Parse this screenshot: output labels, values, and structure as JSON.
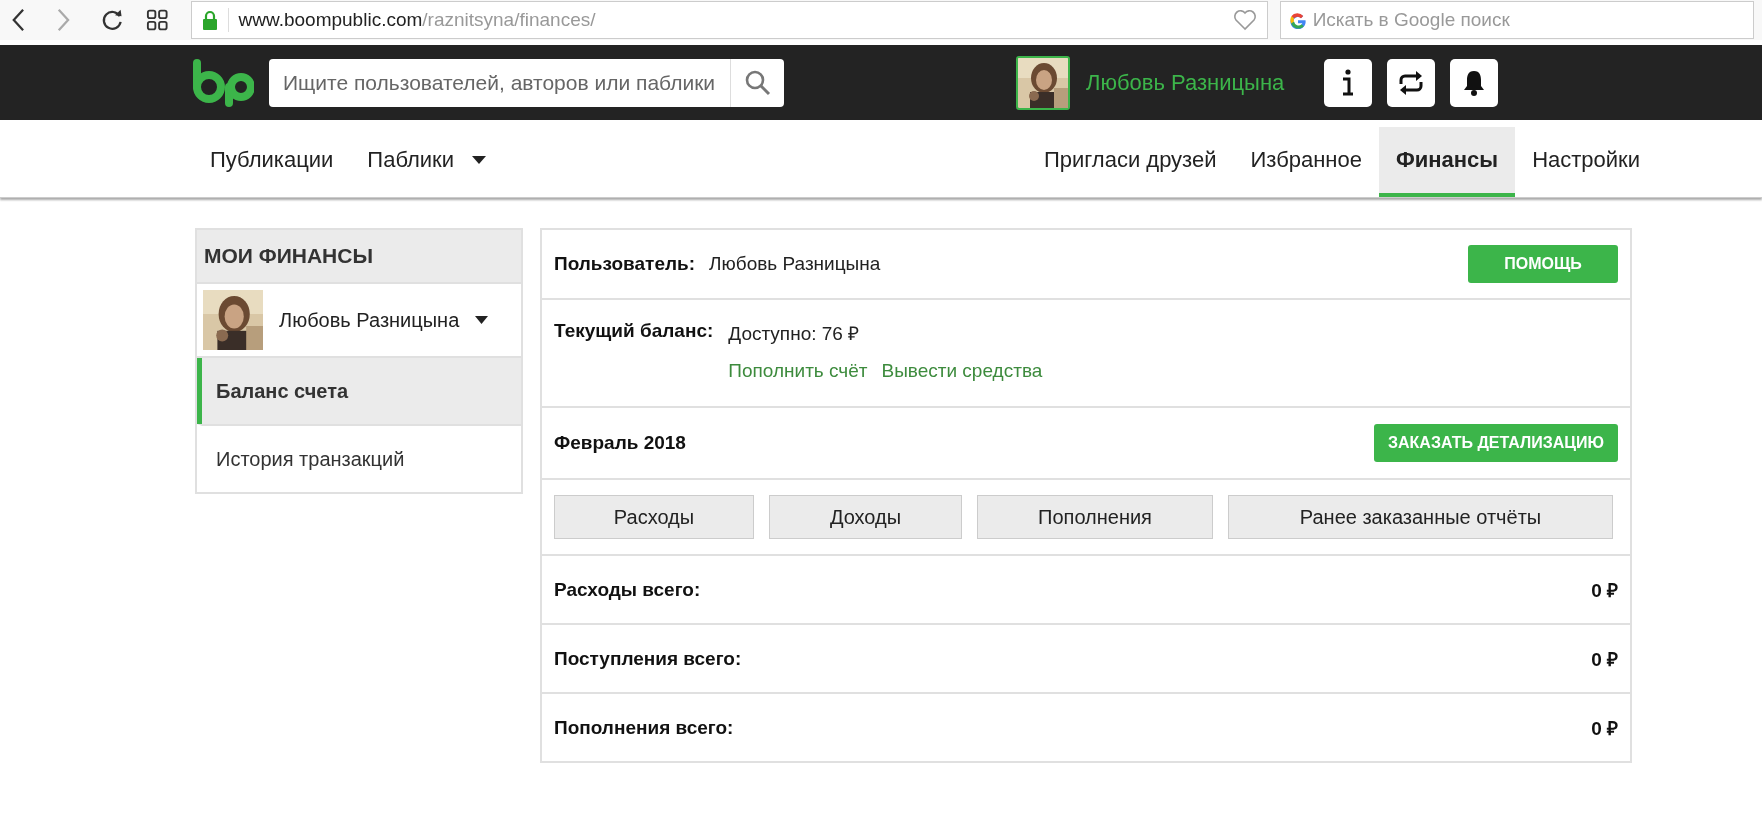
{
  "browser": {
    "url": {
      "domain": "www.boompublic.com",
      "path": "/raznitsyna/finances/"
    },
    "search": {
      "placeholder": "Искать в Google поиск"
    }
  },
  "header": {
    "search": {
      "placeholder": "Ищите пользователей, авторов или паблики"
    },
    "user_name": "Любовь Разницына"
  },
  "nav": {
    "left": [
      {
        "label": "Публикации",
        "dropdown": false
      },
      {
        "label": "Паблики",
        "dropdown": true
      }
    ],
    "tabs": [
      {
        "label": "Пригласи друзей",
        "selected": false
      },
      {
        "label": "Избранное",
        "selected": false
      },
      {
        "label": "Финансы",
        "selected": true
      },
      {
        "label": "Настройки",
        "selected": false
      }
    ]
  },
  "sidebar": {
    "title": "МОИ ФИНАНСЫ",
    "user_name": "Любовь Разницына",
    "items": [
      {
        "label": "Баланс счета",
        "selected": true
      },
      {
        "label": "История транзакций",
        "selected": false
      }
    ]
  },
  "panel": {
    "user_label": "Пользователь:",
    "user_name": "Любовь Разницына",
    "help_button": "ПОМОЩЬ",
    "balance_label": "Текущий баланс:",
    "balance_value": "Доступно: 76 ₽",
    "links": [
      "Пополнить счёт",
      "Вывести средства"
    ],
    "month": "Февраль 2018",
    "order_button": "ЗАКАЗАТЬ ДЕТАЛИЗАЦИЮ",
    "tabs": [
      {
        "label": "Расходы",
        "selected": false
      },
      {
        "label": "Доходы",
        "selected": false
      },
      {
        "label": "Пополнения",
        "selected": false
      },
      {
        "label": "Ранее заказанные отчёты",
        "selected": false
      }
    ],
    "totals": [
      {
        "label": "Расходы всего:",
        "value": "0 ₽"
      },
      {
        "label": "Поступления всего:",
        "value": "0 ₽"
      },
      {
        "label": "Пополнения всего:",
        "value": "0 ₽"
      }
    ]
  }
}
